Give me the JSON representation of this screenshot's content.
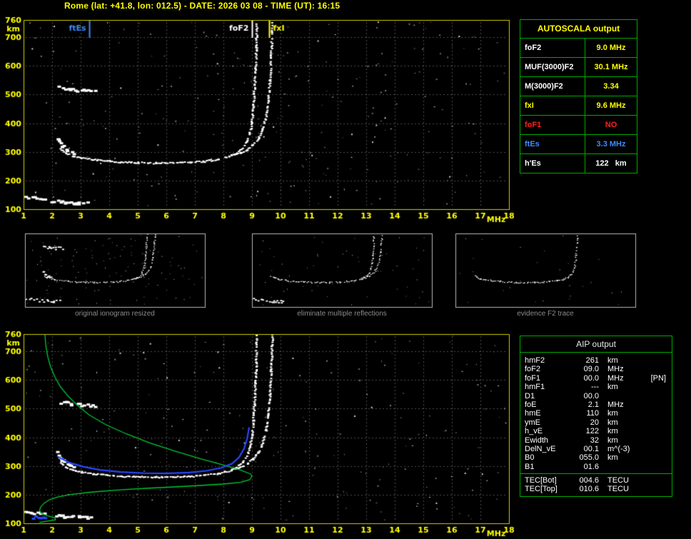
{
  "header": {
    "title": "Rome (lat: +41.8, lon: 012.5) - DATE: 2026 03 08 - TIME (UT): 16:15"
  },
  "autoscala": {
    "title": "AUTOSCALA output",
    "border_color": "#00a800",
    "rows": [
      {
        "label": "foF2",
        "value": "9.0 MHz",
        "label_color": "#ffffff",
        "value_color": "#ffff00"
      },
      {
        "label": "MUF(3000)F2",
        "value": "30.1 MHz",
        "label_color": "#ffffff",
        "value_color": "#ffff00"
      },
      {
        "label": "M(3000)F2",
        "value": "3.34",
        "label_color": "#ffffff",
        "value_color": "#ffff00"
      },
      {
        "label": "fxI",
        "value": "9.6 MHz",
        "label_color": "#ffff00",
        "value_color": "#ffff00"
      },
      {
        "label": "foF1",
        "value": "NO",
        "label_color": "#ff2020",
        "value_color": "#ff2020"
      },
      {
        "label": "ftEs",
        "value": "3.3 MHz",
        "label_color": "#3c8cff",
        "value_color": "#3c8cff"
      },
      {
        "label": "h'Es",
        "value": "122   km",
        "label_color": "#ffffff",
        "value_color": "#ffffff"
      }
    ]
  },
  "thumbnails": [
    {
      "caption": "original ionogram resized"
    },
    {
      "caption": "eliminate multiple reflections"
    },
    {
      "caption": "evidence F2 trace"
    }
  ],
  "aip": {
    "title": "AIP output",
    "border_color": "#00a800",
    "rows": [
      {
        "label": "hmF2",
        "value": "261",
        "unit": "km",
        "extra": ""
      },
      {
        "label": "foF2",
        "value": "09.0",
        "unit": "MHz",
        "extra": ""
      },
      {
        "label": "foF1",
        "value": "00.0",
        "unit": "MHz",
        "extra": "[PN]"
      },
      {
        "label": "hmF1",
        "value": "---",
        "unit": "km",
        "extra": ""
      },
      {
        "label": "D1",
        "value": "00.0",
        "unit": "",
        "extra": ""
      },
      {
        "label": "foE",
        "value": "2.1",
        "unit": "MHz",
        "extra": ""
      },
      {
        "label": "hmE",
        "value": "110",
        "unit": "km",
        "extra": ""
      },
      {
        "label": "ymE",
        "value": "20",
        "unit": "km",
        "extra": ""
      },
      {
        "label": "h_vE",
        "value": "122",
        "unit": "km",
        "extra": ""
      },
      {
        "label": "Ewidth",
        "value": "32",
        "unit": "km",
        "extra": ""
      },
      {
        "label": "DelN_vE",
        "value": "00.1",
        "unit": "m^(-3)",
        "extra": ""
      },
      {
        "label": "B0",
        "value": "055.0",
        "unit": "km",
        "extra": ""
      },
      {
        "label": "B1",
        "value": "01.6",
        "unit": "",
        "extra": ""
      }
    ],
    "tec_rows": [
      {
        "label": "TEC[Bot]",
        "value": "004.6",
        "unit": "TECU",
        "extra": ""
      },
      {
        "label": "TEC[Top]",
        "value": "010.6",
        "unit": "TECU",
        "extra": ""
      }
    ]
  },
  "chart_data": [
    {
      "type": "scatter",
      "title": "Ionogram with AUTOSCALA scaling markers",
      "xlabel": "MHz",
      "ylabel": "km",
      "xlim": [
        1,
        18
      ],
      "ylim": [
        100,
        760
      ],
      "xticks": [
        1,
        2,
        3,
        4,
        5,
        6,
        7,
        8,
        9,
        10,
        11,
        12,
        13,
        14,
        15,
        16,
        17,
        18
      ],
      "yticks": [
        100,
        200,
        300,
        400,
        500,
        600,
        700,
        760
      ],
      "grid": true,
      "series": [
        {
          "name": "Es echo low segment",
          "style": "blob",
          "color": "#ffffff",
          "points": [
            [
              1.05,
              143
            ],
            [
              1.4,
              140
            ],
            [
              1.7,
              138
            ]
          ]
        },
        {
          "name": "Es echo main segment (h'Es 122 km, ftEs 3.3 MHz)",
          "style": "blob",
          "color": "#ffffff",
          "points": [
            [
              1.95,
              130
            ],
            [
              2.4,
              127
            ],
            [
              2.9,
              125
            ],
            [
              3.3,
              123
            ]
          ]
        },
        {
          "name": "F-trace leading edge spread",
          "style": "blob",
          "color": "#ffffff",
          "points": [
            [
              2.15,
              348
            ],
            [
              2.3,
              325
            ],
            [
              2.5,
              308
            ],
            [
              2.7,
              297
            ]
          ]
        },
        {
          "name": "F2 ordinary trace (foF2 9.0 MHz)",
          "style": "trace",
          "color": "#ffffff",
          "points": [
            [
              2.25,
              312
            ],
            [
              2.45,
              298
            ],
            [
              2.7,
              288
            ],
            [
              3.0,
              281
            ],
            [
              3.4,
              275
            ],
            [
              3.9,
              270
            ],
            [
              4.4,
              266
            ],
            [
              5.0,
              264
            ],
            [
              5.6,
              263
            ],
            [
              6.2,
              263
            ],
            [
              6.8,
              265
            ],
            [
              7.3,
              269
            ],
            [
              7.8,
              276
            ],
            [
              8.15,
              285
            ],
            [
              8.45,
              298
            ],
            [
              8.65,
              315
            ],
            [
              8.8,
              338
            ],
            [
              8.9,
              368
            ],
            [
              8.97,
              408
            ],
            [
              9.02,
              458
            ],
            [
              9.06,
              520
            ],
            [
              9.09,
              590
            ],
            [
              9.12,
              665
            ],
            [
              9.14,
              755
            ]
          ]
        },
        {
          "name": "F2 extraordinary trace (fxI 9.6 MHz)",
          "style": "trace",
          "color": "#ffffff",
          "points": [
            [
              8.25,
              290
            ],
            [
              8.55,
              298
            ],
            [
              8.8,
              310
            ],
            [
              9.0,
              326
            ],
            [
              9.2,
              350
            ],
            [
              9.35,
              382
            ],
            [
              9.46,
              425
            ],
            [
              9.54,
              480
            ],
            [
              9.6,
              550
            ],
            [
              9.64,
              630
            ],
            [
              9.67,
              720
            ],
            [
              9.68,
              758
            ]
          ]
        },
        {
          "name": "second-order F echo",
          "style": "blob",
          "color": "#ffffff",
          "points": [
            [
              2.2,
              527
            ],
            [
              2.6,
              520
            ],
            [
              3.0,
              516
            ],
            [
              3.45,
              513
            ]
          ]
        }
      ],
      "markers": [
        {
          "label": "ftEs",
          "freq": 3.3,
          "color": "#3c8cff",
          "side": "left"
        },
        {
          "label": "foF2",
          "freq": 9.0,
          "color": "#ffffff",
          "side": "left"
        },
        {
          "label": "fxI",
          "freq": 9.6,
          "color": "#ffff00",
          "side": "right"
        }
      ]
    },
    {
      "type": "scatter",
      "title": "Ionogram with AIP electron density profile and fitted F2 trace",
      "xlabel": "MHz",
      "ylabel": "km",
      "xlim": [
        1,
        18
      ],
      "ylim": [
        100,
        760
      ],
      "xticks": [
        1,
        2,
        3,
        4,
        5,
        6,
        7,
        8,
        9,
        10,
        11,
        12,
        13,
        14,
        15,
        16,
        17,
        18
      ],
      "yticks": [
        100,
        200,
        300,
        400,
        500,
        600,
        700,
        760
      ],
      "grid": true,
      "series": [
        {
          "name": "Es echo low segment",
          "style": "blob",
          "color": "#ffffff",
          "points": [
            [
              1.05,
              143
            ],
            [
              1.4,
              140
            ],
            [
              1.7,
              138
            ]
          ]
        },
        {
          "name": "Es echo main segment",
          "style": "blob",
          "color": "#ffffff",
          "points": [
            [
              1.95,
              130
            ],
            [
              2.4,
              127
            ],
            [
              2.9,
              125
            ],
            [
              3.3,
              123
            ]
          ]
        },
        {
          "name": "F-trace leading edge spread",
          "style": "blob",
          "color": "#ffffff",
          "points": [
            [
              2.15,
              348
            ],
            [
              2.3,
              325
            ],
            [
              2.5,
              308
            ],
            [
              2.7,
              297
            ]
          ]
        },
        {
          "name": "F2 ordinary trace",
          "style": "trace",
          "color": "#ffffff",
          "points": [
            [
              2.25,
              312
            ],
            [
              2.45,
              298
            ],
            [
              2.7,
              288
            ],
            [
              3.0,
              281
            ],
            [
              3.4,
              275
            ],
            [
              3.9,
              270
            ],
            [
              4.4,
              266
            ],
            [
              5.0,
              264
            ],
            [
              5.6,
              263
            ],
            [
              6.2,
              263
            ],
            [
              6.8,
              265
            ],
            [
              7.3,
              269
            ],
            [
              7.8,
              276
            ],
            [
              8.15,
              285
            ],
            [
              8.45,
              298
            ],
            [
              8.65,
              315
            ],
            [
              8.8,
              338
            ],
            [
              8.9,
              368
            ],
            [
              8.97,
              408
            ],
            [
              9.02,
              458
            ],
            [
              9.06,
              520
            ],
            [
              9.09,
              590
            ],
            [
              9.12,
              665
            ],
            [
              9.14,
              755
            ]
          ]
        },
        {
          "name": "F2 extraordinary trace",
          "style": "trace",
          "color": "#ffffff",
          "points": [
            [
              8.25,
              290
            ],
            [
              8.55,
              298
            ],
            [
              8.8,
              310
            ],
            [
              9.0,
              326
            ],
            [
              9.2,
              350
            ],
            [
              9.35,
              382
            ],
            [
              9.46,
              425
            ],
            [
              9.54,
              480
            ],
            [
              9.6,
              550
            ],
            [
              9.64,
              630
            ],
            [
              9.67,
              720
            ],
            [
              9.68,
              758
            ]
          ]
        },
        {
          "name": "second-order F echo",
          "style": "blob",
          "color": "#ffffff",
          "points": [
            [
              2.2,
              527
            ],
            [
              2.6,
              520
            ],
            [
              3.0,
              516
            ],
            [
              3.45,
              513
            ]
          ]
        },
        {
          "name": "electron density profile (hmF2 261 km, foF2 9.0 MHz, foE 2.1 MHz)",
          "style": "line",
          "color": "#00c832",
          "points": [
            [
              1.75,
              758
            ],
            [
              1.78,
              720
            ],
            [
              1.85,
              680
            ],
            [
              1.95,
              645
            ],
            [
              2.1,
              610
            ],
            [
              2.3,
              575
            ],
            [
              2.55,
              545
            ],
            [
              2.9,
              510
            ],
            [
              3.3,
              478
            ],
            [
              3.9,
              443
            ],
            [
              4.6,
              412
            ],
            [
              5.4,
              381
            ],
            [
              6.3,
              352
            ],
            [
              7.2,
              325
            ],
            [
              8.0,
              303
            ],
            [
              8.6,
              286
            ],
            [
              8.95,
              272
            ],
            [
              9.0,
              265
            ],
            [
              8.92,
              252
            ],
            [
              8.6,
              243
            ],
            [
              8.0,
              237
            ],
            [
              7.2,
              232
            ],
            [
              6.3,
              227
            ],
            [
              5.3,
              222
            ],
            [
              4.3,
              216
            ],
            [
              3.4,
              209
            ],
            [
              2.7,
              201
            ],
            [
              2.2,
              192
            ],
            [
              1.9,
              182
            ],
            [
              1.72,
              170
            ],
            [
              1.6,
              157
            ],
            [
              1.56,
              145
            ],
            [
              1.62,
              134
            ],
            [
              1.85,
              126
            ],
            [
              2.1,
              119
            ],
            [
              2.12,
              112
            ],
            [
              1.8,
              107
            ],
            [
              1.55,
              103
            ]
          ]
        },
        {
          "name": "AUTOSCALA fitted F2 trace",
          "style": "line2",
          "color": "#2946ff",
          "points": [
            [
              2.2,
              332
            ],
            [
              2.6,
              312
            ],
            [
              3.1,
              297
            ],
            [
              3.7,
              286
            ],
            [
              4.4,
              279
            ],
            [
              5.2,
              275
            ],
            [
              6.0,
              274
            ],
            [
              6.8,
              277
            ],
            [
              7.4,
              283
            ],
            [
              7.9,
              293
            ],
            [
              8.3,
              308
            ],
            [
              8.55,
              330
            ],
            [
              8.72,
              360
            ],
            [
              8.83,
              395
            ],
            [
              8.9,
              435
            ]
          ]
        },
        {
          "name": "Es height marker (122 km)",
          "style": "blob",
          "color": "#2946ff",
          "points": [
            [
              1.3,
              124
            ],
            [
              1.7,
              121
            ]
          ]
        }
      ],
      "markers": []
    }
  ]
}
